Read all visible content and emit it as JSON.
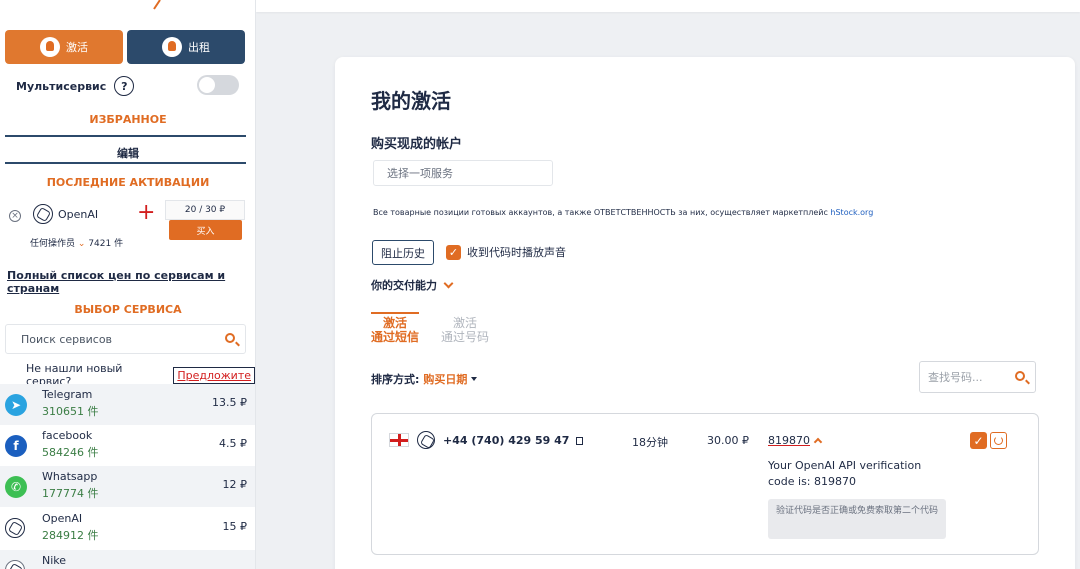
{
  "sidebar": {
    "activate_label": "激活",
    "rent_label": "出租",
    "multiservice_label": "Мультисервис",
    "help_glyph": "?",
    "favorites_title": "ИЗБРАННОЕ",
    "edit_label": "编辑",
    "recent_title": "ПОСЛЕДНИЕ АКТИВАЦИИ",
    "recent": {
      "remove_glyph": "×",
      "service": "OpenAI",
      "plus_glyph": "+",
      "price": "20 / 30 ₽",
      "buy_label": "买入",
      "operator": "任何操作员",
      "count": "7421 件"
    },
    "price_list_link": "Полный список цен по сервисам и странам",
    "choose_title": "ВЫБОР СЕРВИСА",
    "search_placeholder": "Поиск сервисов",
    "not_found_text": "Не нашли новый сервис?",
    "suggest_link": "Предложите",
    "services": [
      {
        "name": "Telegram",
        "count": "310651 件",
        "price": "13.5 ₽",
        "icon": "telegram-icon",
        "color": "#2aa3e0"
      },
      {
        "name": "facebook",
        "count": "584246 件",
        "price": "4.5 ₽",
        "icon": "facebook-icon",
        "color": "#1b5fbf"
      },
      {
        "name": "Whatsapp",
        "count": "177774 件",
        "price": "12 ₽",
        "icon": "whatsapp-icon",
        "color": "#3dbf54"
      },
      {
        "name": "OpenAI",
        "count": "284912 件",
        "price": "15 ₽",
        "icon": "openai-icon",
        "color": "#ffffff"
      },
      {
        "name": "Nike",
        "count": "",
        "price": "",
        "icon": "nike-icon",
        "color": "#ffffff"
      }
    ]
  },
  "main": {
    "title": "我的激活",
    "buy_account_title": "购买现成的帐户",
    "service_placeholder": "选择一项服务",
    "notice": "Все товарные позиции готовых аккаунтов, а также ОТВЕТСТВЕННОСТЬ за них, осуществляет маркетплейс",
    "notice_link": "hStock.org",
    "history_button": "阻止历史",
    "sound_label": "收到代码时播放声音",
    "check_glyph": "✓",
    "delivery_label": "你的交付能力",
    "tabs": [
      {
        "line1": "激活",
        "line2": "通过短信"
      },
      {
        "line1": "激活",
        "line2": "通过号码"
      }
    ],
    "sort_label": "排序方式:",
    "sort_value": "购买日期",
    "phone_search_placeholder": "查找号码...",
    "order": {
      "phone": "+44 (740) 429 59 47",
      "time": "18分钟",
      "price": "30.00 ₽",
      "code": "819870",
      "sms": "Your OpenAI API verification code is: 819870",
      "hint": "验证代码是否正确或免费索取第二个代码",
      "confirm_glyph": "✓"
    }
  },
  "colors": {
    "accent": "#e06c23",
    "navy": "#2c4a6b",
    "count_green": "#3a7d44"
  }
}
